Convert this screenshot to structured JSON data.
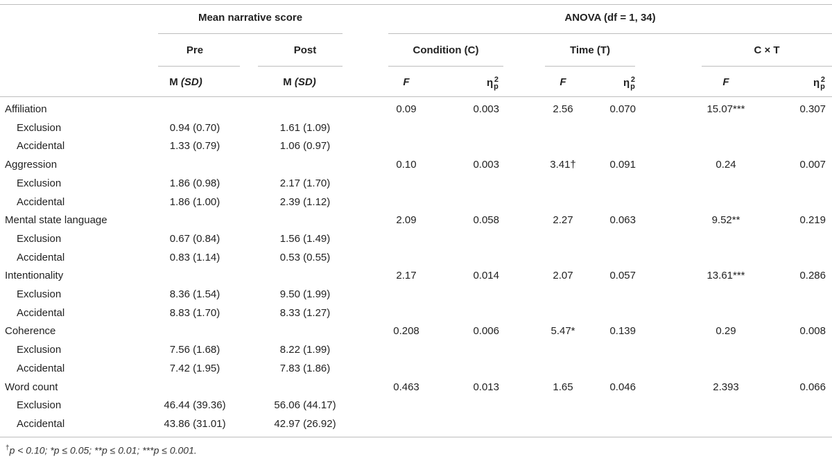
{
  "table": {
    "header": {
      "group_mean": "Mean narrative score",
      "group_anova": "ANOVA (df = 1, 34)",
      "pre": "Pre",
      "post": "Post",
      "condition": "Condition (C)",
      "time": "Time (T)",
      "interaction": "C × T",
      "m": "M ",
      "sd": "(SD)",
      "f": "F",
      "eta": "η",
      "eta_sup": "2",
      "eta_sub": "p"
    },
    "rows": [
      {
        "label": "Affiliation",
        "cf": "0.09",
        "ce": "0.003",
        "tf": "2.56",
        "te": "0.070",
        "xf": "15.07***",
        "xe": "0.307"
      },
      {
        "label": "Exclusion",
        "pre": "0.94 (0.70)",
        "post": "1.61 (1.09)"
      },
      {
        "label": "Accidental",
        "pre": "1.33 (0.79)",
        "post": "1.06 (0.97)"
      },
      {
        "label": "Aggression",
        "cf": "0.10",
        "ce": "0.003",
        "tf": "3.41†",
        "te": "0.091",
        "xf": "0.24",
        "xe": "0.007"
      },
      {
        "label": "Exclusion",
        "pre": "1.86 (0.98)",
        "post": "2.17 (1.70)"
      },
      {
        "label": "Accidental",
        "pre": "1.86 (1.00)",
        "post": "2.39 (1.12)"
      },
      {
        "label": "Mental state language",
        "cf": "2.09",
        "ce": "0.058",
        "tf": "2.27",
        "te": "0.063",
        "xf": "9.52**",
        "xe": "0.219"
      },
      {
        "label": "Exclusion",
        "pre": "0.67 (0.84)",
        "post": "1.56 (1.49)"
      },
      {
        "label": "Accidental",
        "pre": "0.83 (1.14)",
        "post": "0.53 (0.55)"
      },
      {
        "label": "Intentionality",
        "cf": "2.17",
        "ce": "0.014",
        "tf": "2.07",
        "te": "0.057",
        "xf": "13.61***",
        "xe": "0.286"
      },
      {
        "label": "Exclusion",
        "pre": "8.36 (1.54)",
        "post": "9.50 (1.99)"
      },
      {
        "label": "Accidental",
        "pre": "8.83 (1.70)",
        "post": "8.33 (1.27)"
      },
      {
        "label": "Coherence",
        "cf": "0.208",
        "ce": "0.006",
        "tf": "5.47*",
        "te": "0.139",
        "xf": "0.29",
        "xe": "0.008"
      },
      {
        "label": "Exclusion",
        "pre": "7.56 (1.68)",
        "post": "8.22 (1.99)"
      },
      {
        "label": "Accidental",
        "pre": "7.42 (1.95)",
        "post": "7.83 (1.86)"
      },
      {
        "label": "Word count",
        "cf": "0.463",
        "ce": "0.013",
        "tf": "1.65",
        "te": "0.046",
        "xf": "2.393",
        "xe": "0.066"
      },
      {
        "label": "Exclusion",
        "pre": "46.44 (39.36)",
        "post": "56.06 (44.17)"
      },
      {
        "label": "Accidental",
        "pre": "43.86 (31.01)",
        "post": "42.97 (26.92)"
      }
    ],
    "footnote_dagger": "†",
    "footnote_text": "p < 0.10; *p ≤ 0.05; **p ≤ 0.01; ***p ≤ 0.001."
  }
}
